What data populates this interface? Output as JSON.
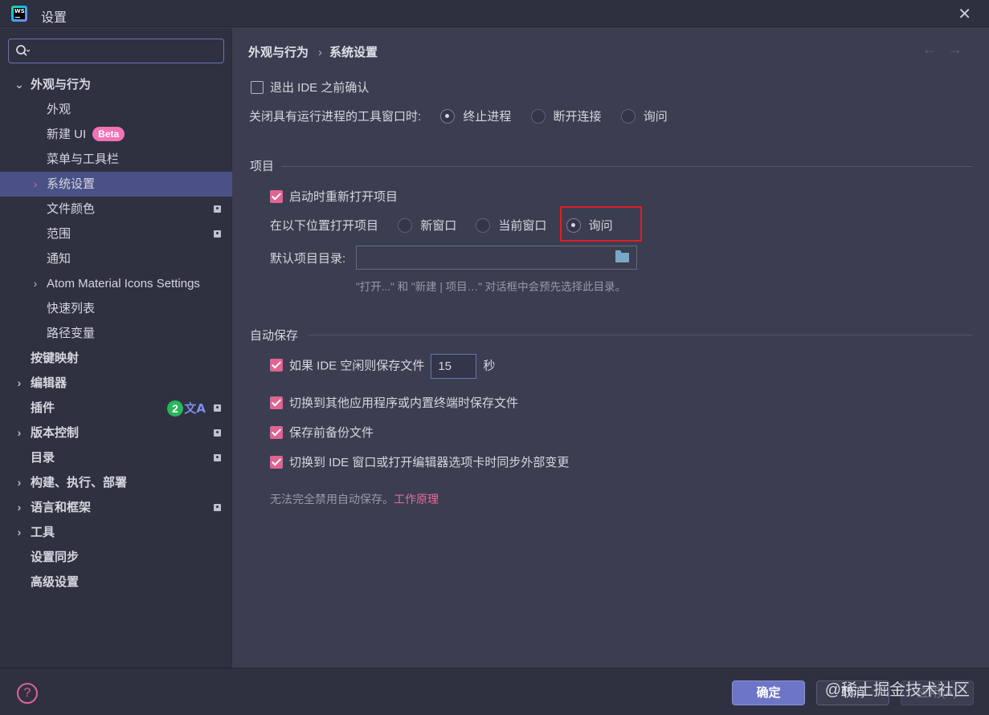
{
  "window": {
    "title": "设置",
    "close_glyph": "✕"
  },
  "sidebar": {
    "search": {
      "value": "",
      "placeholder": ""
    },
    "items": [
      {
        "label": "外观与行为",
        "expanded": true
      },
      {
        "label": "外观"
      },
      {
        "label": "新建 UI",
        "badge": "Beta"
      },
      {
        "label": "菜单与工具栏"
      },
      {
        "label": "系统设置",
        "selected": true
      },
      {
        "label": "文件颜色"
      },
      {
        "label": "范围"
      },
      {
        "label": "通知"
      },
      {
        "label": "Atom Material Icons Settings"
      },
      {
        "label": "快速列表"
      },
      {
        "label": "路径变量"
      },
      {
        "label": "按键映射"
      },
      {
        "label": "编辑器"
      },
      {
        "label": "插件",
        "badge_count": "2"
      },
      {
        "label": "版本控制"
      },
      {
        "label": "目录"
      },
      {
        "label": "构建、执行、部署"
      },
      {
        "label": "语言和框架"
      },
      {
        "label": "工具"
      },
      {
        "label": "设置同步"
      },
      {
        "label": "高级设置"
      }
    ],
    "translate_glyph": "文A"
  },
  "header": {
    "breadcrumb": [
      "外观与行为",
      "系统设置"
    ],
    "separator": "›",
    "back_glyph": "←",
    "forward_glyph": "→"
  },
  "general": {
    "confirm_exit": {
      "label": "退出 IDE 之前确认",
      "checked": false
    },
    "close_tool_window": {
      "label": "关闭具有运行进程的工具窗口时:",
      "options": [
        "终止进程",
        "断开连接",
        "询问"
      ],
      "selected": "终止进程"
    }
  },
  "project": {
    "section_title": "项目",
    "reopen": {
      "label": "启动时重新打开项目",
      "checked": true
    },
    "open_location": {
      "label": "在以下位置打开项目",
      "options": [
        "新窗口",
        "当前窗口",
        "询问"
      ],
      "selected": "询问"
    },
    "default_dir": {
      "label": "默认项目目录:",
      "value": "",
      "hint": "\"打开...\" 和 \"新建 | 项目…\" 对话框中会预先选择此目录。"
    }
  },
  "autosave": {
    "section_title": "自动保存",
    "idle": {
      "label_before": "如果 IDE 空闲则保存文件",
      "value": "15",
      "label_after": "秒",
      "checked": true
    },
    "switch_app": {
      "label": "切换到其他应用程序或内置终端时保存文件",
      "checked": true
    },
    "backup": {
      "label": "保存前备份文件",
      "checked": true
    },
    "sync_external": {
      "label": "切换到 IDE 窗口或打开编辑器选项卡时同步外部变更",
      "checked": true
    },
    "note": "无法完全禁用自动保存。",
    "note_link": "工作原理"
  },
  "footer": {
    "help_glyph": "?",
    "ok": "确定",
    "cancel": "取消",
    "apply": "应用(A)",
    "watermark": "@稀土掘金技术社区"
  },
  "colors": {
    "accent": "#e06391",
    "selection": "#4a5187",
    "highlight_box": "#e01e28"
  }
}
